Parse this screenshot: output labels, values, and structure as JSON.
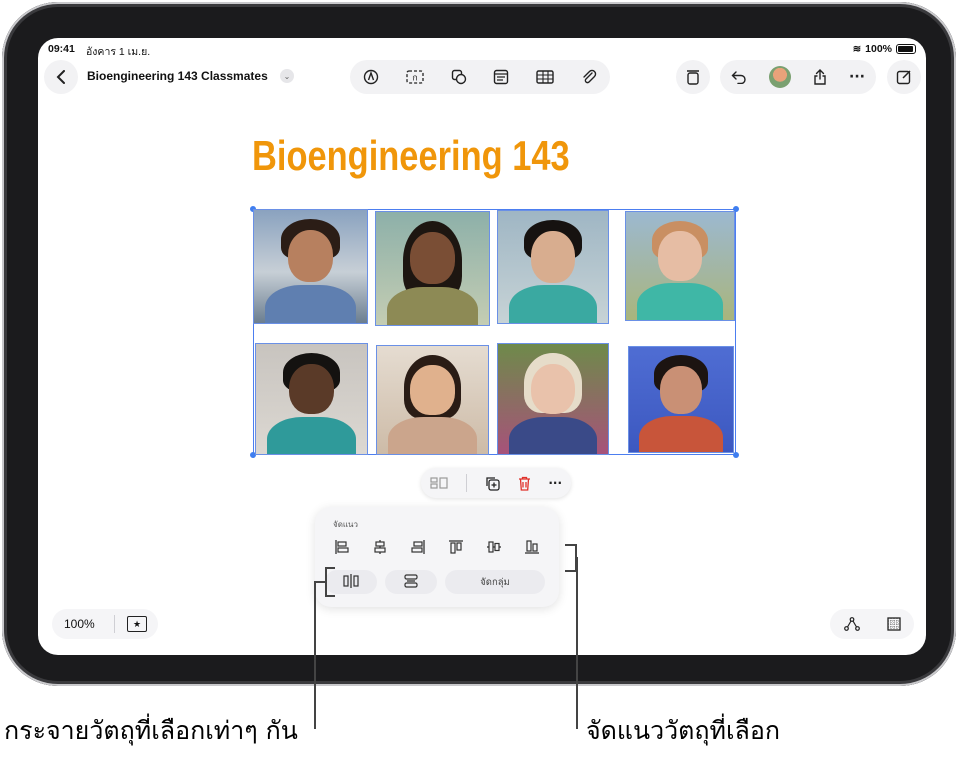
{
  "status": {
    "time": "09:41",
    "date": "อังคาร 1 เม.ย.",
    "battery": "100%"
  },
  "header": {
    "title": "Bioengineering 143 Classmates"
  },
  "board": {
    "title": "Bioengineering 143"
  },
  "zoom": {
    "level": "100%"
  },
  "align_panel": {
    "header": "จัดแนว",
    "group_label": "จัดกลุ่ม"
  },
  "callouts": {
    "distribute": "กระจายวัตถุที่เลือกเท่าๆ กัน",
    "align": "จัดแนววัตถุที่เลือก"
  },
  "icons": [
    "back-icon",
    "chevron-down-icon",
    "pen-icon",
    "textbox-icon",
    "shapes-icon",
    "note-icon",
    "table-icon",
    "attachment-icon",
    "trash-stack-icon",
    "undo-icon",
    "avatar",
    "share-icon",
    "more-icon",
    "compose-icon",
    "arrange-icon",
    "duplicate-icon",
    "delete-icon",
    "star-icon",
    "connector-icon",
    "grid-icon"
  ],
  "colors": {
    "accent": "#3f7ef0",
    "title": "#f0960a",
    "delete": "#e0302a"
  }
}
